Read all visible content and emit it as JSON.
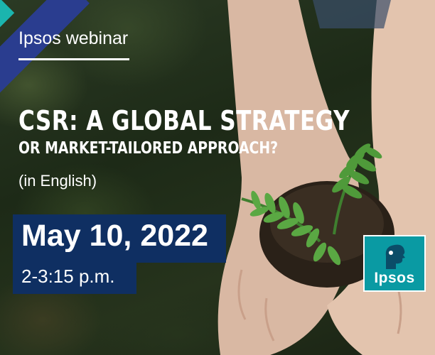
{
  "banner": {
    "eyebrow": "Ipsos webinar",
    "title_line_1": "CSR: A GLOBAL STRATEGY",
    "title_line_2": "OR MARKET-TAILORED APPROACH?",
    "language": "(in English)",
    "date": "May 10, 2022",
    "time": "2-3:15 p.m."
  },
  "logo": {
    "text": "Ipsos",
    "color": "#0a9aa3"
  },
  "colors": {
    "accent_teal": "#1bb5ae",
    "accent_navy": "#2a3d8f",
    "date_box": "#0f2f62",
    "text": "#ffffff"
  },
  "imagery": {
    "photo_subject_icon": "hands-holding-seedling-icon"
  }
}
